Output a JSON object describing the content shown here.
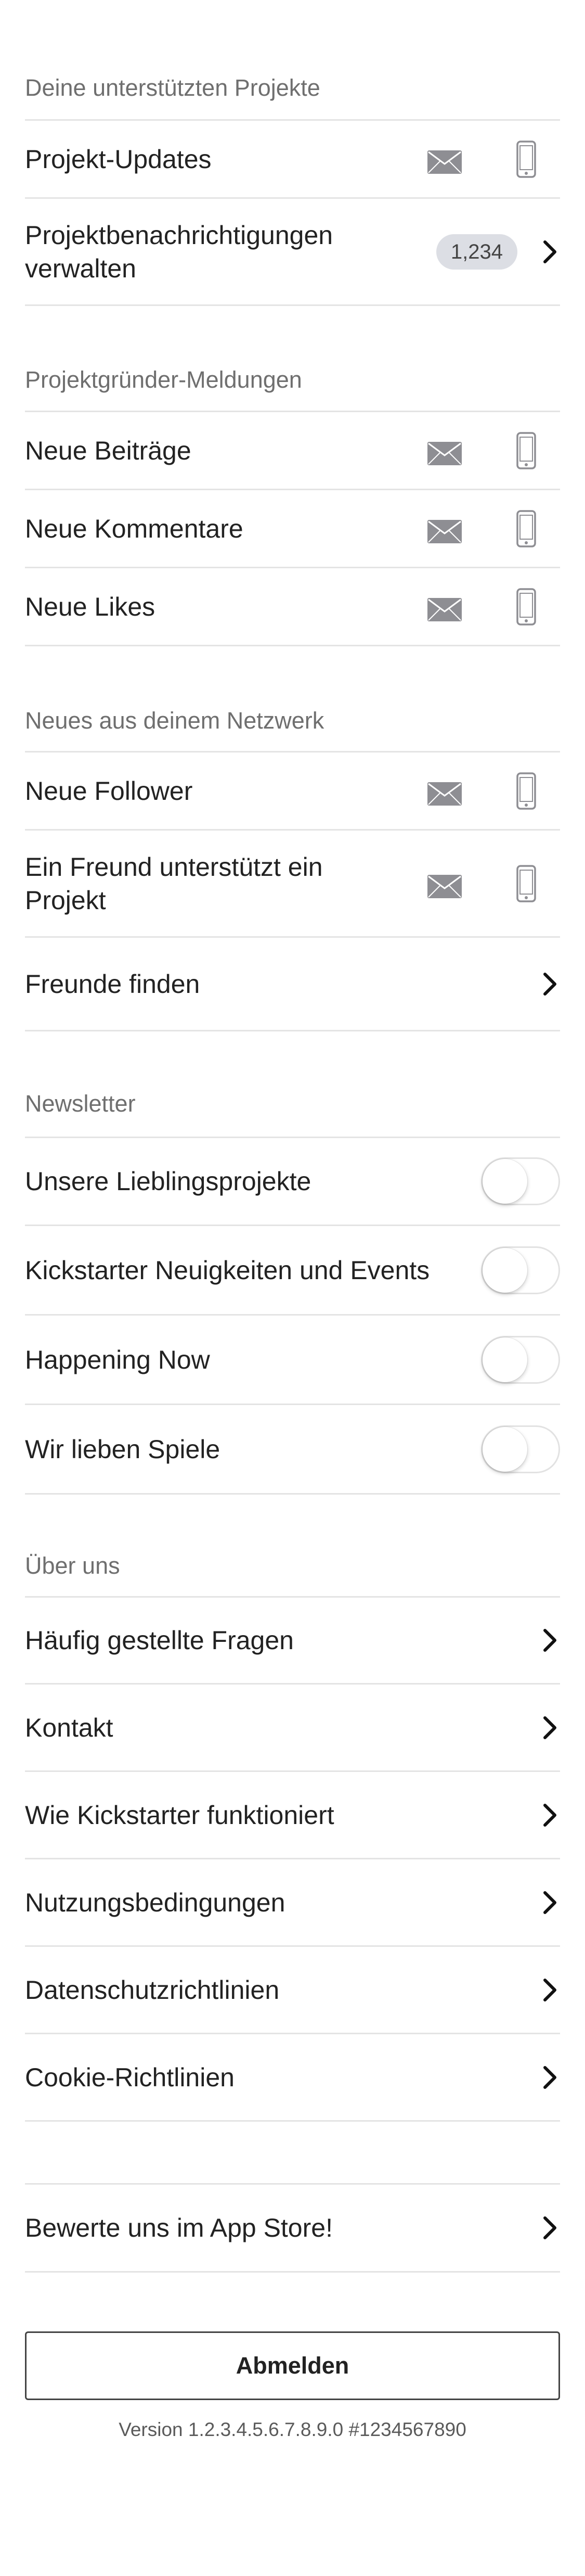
{
  "colors": {
    "icon_gray": "#8e8e93",
    "divider": "#e4e4e4",
    "section_header": "#6f6f6f",
    "badge_bg": "#dcdee4"
  },
  "sections": {
    "backed_projects": {
      "header": "Deine unterstützten Projekte",
      "project_updates": "Projekt-Updates",
      "manage_notifications": "Projektbenachrichtigungen verwalten",
      "manage_badge": "1,234"
    },
    "creator": {
      "header": "Projektgründer-Meldungen",
      "new_posts": "Neue Beiträge",
      "new_comments": "Neue Kommentare",
      "new_likes": "Neue Likes"
    },
    "network": {
      "header": "Neues aus deinem Netzwerk",
      "new_followers": "Neue Follower",
      "friend_backs": "Ein Freund unterstützt ein Projekt",
      "find_friends": "Freunde finden"
    },
    "newsletter": {
      "header": "Newsletter",
      "favorites": "Unsere Lieblingsprojekte",
      "news_events": "Kickstarter Neuigkeiten und Events",
      "happening_now": "Happening Now",
      "games": "Wir lieben Spiele",
      "toggles_on": [
        false,
        false,
        false,
        false
      ]
    },
    "about": {
      "header": "Über uns",
      "faq": "Häufig gestellte Fragen",
      "contact": "Kontakt",
      "how_it_works": "Wie Kickstarter funktioniert",
      "terms": "Nutzungsbedingungen",
      "privacy": "Datenschutzrichtlinien",
      "cookies": "Cookie-Richtlinien"
    },
    "rate": {
      "label": "Bewerte uns im App Store!"
    }
  },
  "logout_label": "Abmelden",
  "version": "Version 1.2.3.4.5.6.7.8.9.0 #1234567890",
  "icons": {
    "email": "mail-icon",
    "push": "phone-icon",
    "disclosure": "chevron-right-icon"
  }
}
